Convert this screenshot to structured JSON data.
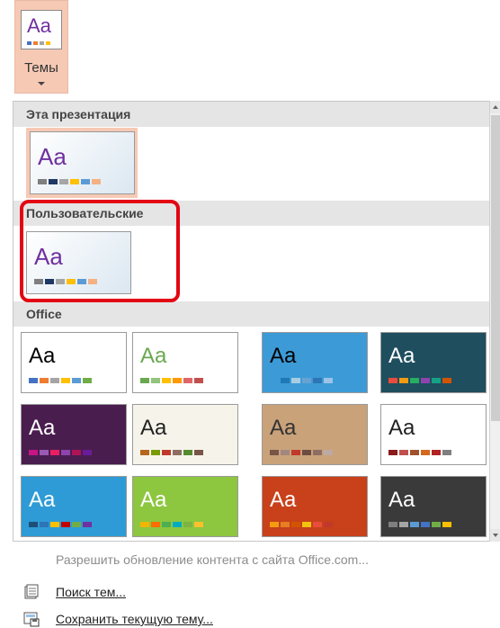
{
  "ribbon": {
    "themes_label": "Темы",
    "icon_text": "Aa"
  },
  "gallery": {
    "sections": [
      {
        "title": "Эта презентация"
      },
      {
        "title": "Пользовательские"
      },
      {
        "title": "Office"
      }
    ],
    "current_theme": {
      "text": "Aa",
      "swatches": [
        "#7f7f7f",
        "#1f3864",
        "#a5a5a5",
        "#ffc000",
        "#5b9bd5",
        "#f4b183"
      ]
    },
    "custom_theme": {
      "text": "Aa",
      "swatches": [
        "#7f7f7f",
        "#1f3864",
        "#a5a5a5",
        "#ffc000",
        "#5b9bd5",
        "#f4b183"
      ]
    },
    "office_themes": [
      {
        "text": "Aa",
        "text_color": "#000000",
        "bg": "#ffffff",
        "swatches": [
          "#4472c4",
          "#ed7d31",
          "#a5a5a5",
          "#ffc000",
          "#5b9bd5",
          "#70ad47"
        ]
      },
      {
        "text": "Aa",
        "text_color": "#6aa84f",
        "bg": "#ffffff",
        "swatches": [
          "#6aa84f",
          "#93c47d",
          "#ffc000",
          "#ff9900",
          "#e06666",
          "#c0504d"
        ]
      },
      {
        "text": "Aa",
        "text_color": "#000000",
        "bg": "#3c9bd6",
        "swatches": [
          "#3c9bd6",
          "#1f78b4",
          "#a6cee3",
          "#66a3d2",
          "#2e75b6",
          "#9dc3e6"
        ]
      },
      {
        "text": "Aa",
        "text_color": "#ffffff",
        "bg": "#1f4e5f",
        "swatches": [
          "#e74c3c",
          "#f39c12",
          "#27ae60",
          "#8e44ad",
          "#16a085",
          "#d35400"
        ]
      },
      {
        "text": "Aa",
        "text_color": "#ffffff",
        "bg": "#4a1d4f",
        "swatches": [
          "#c71585",
          "#9b59b6",
          "#e91e63",
          "#8e44ad",
          "#ad1457",
          "#6a1b9a"
        ]
      },
      {
        "text": "Aa",
        "text_color": "#222222",
        "bg": "#f6f4ea",
        "swatches": [
          "#b5651d",
          "#7a9a01",
          "#c0392b",
          "#8d6e63",
          "#558b2f",
          "#795548"
        ]
      },
      {
        "text": "Aa",
        "text_color": "#333333",
        "bg": "#c9a27a",
        "swatches": [
          "#795548",
          "#a1887f",
          "#c0392b",
          "#6d4c41",
          "#8d6e63",
          "#bcaaa4"
        ]
      },
      {
        "text": "Aa",
        "text_color": "#222222",
        "bg": "#ffffff",
        "swatches": [
          "#8b1a1a",
          "#c0504d",
          "#a0522d",
          "#d2691e",
          "#b22222",
          "#7f7f7f"
        ]
      },
      {
        "text": "Aa",
        "text_color": "#ffffff",
        "bg": "#2e9bd6",
        "swatches": [
          "#1f4e79",
          "#2e75b6",
          "#ffc000",
          "#c00000",
          "#70ad47",
          "#7030a0"
        ]
      },
      {
        "text": "Aa",
        "text_color": "#ffffff",
        "bg": "#8dc63f",
        "swatches": [
          "#f4b400",
          "#ff6d00",
          "#4caf50",
          "#00acc1",
          "#7cb342",
          "#fbc02d"
        ]
      },
      {
        "text": "Aa",
        "text_color": "#ffffff",
        "bg": "#c8411a",
        "swatches": [
          "#f39c12",
          "#e67e22",
          "#d35400",
          "#f1c40f",
          "#e74c3c",
          "#c0392b"
        ]
      },
      {
        "text": "Aa",
        "text_color": "#ffffff",
        "bg": "#3a3a3a",
        "swatches": [
          "#7f7f7f",
          "#a5a5a5",
          "#5b9bd5",
          "#4472c4",
          "#70ad47",
          "#ffc000"
        ]
      }
    ]
  },
  "menu": {
    "allow_updates": "Разрешить обновление контента с сайта Office.com...",
    "browse_themes": "Поиск тем...",
    "save_theme": "Сохранить текущую тему..."
  },
  "colors": {
    "highlight": "#f6c9b4",
    "annotation_red": "#e30613"
  }
}
